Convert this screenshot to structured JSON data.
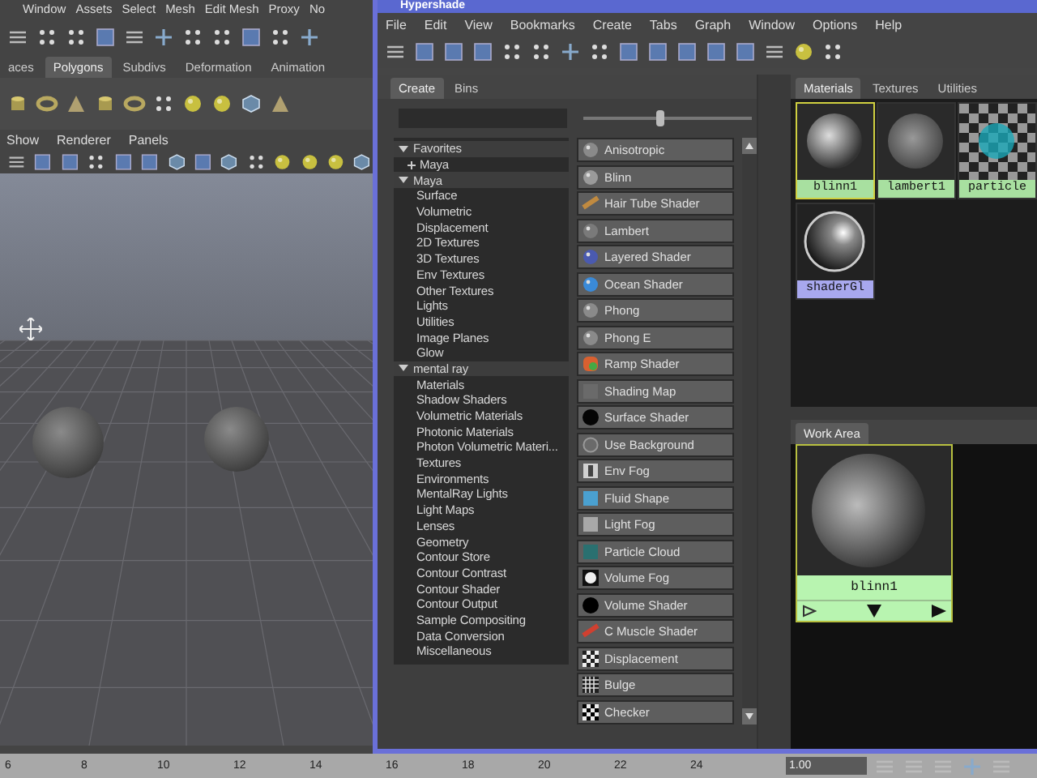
{
  "maya": {
    "menu": [
      "Window",
      "Assets",
      "Select",
      "Mesh",
      "Edit Mesh",
      "Proxy",
      "No"
    ],
    "shelf_tabs": [
      {
        "label": "aces",
        "selected": false
      },
      {
        "label": "Polygons",
        "selected": true
      },
      {
        "label": "Subdivs",
        "selected": false
      },
      {
        "label": "Deformation",
        "selected": false
      },
      {
        "label": "Animation",
        "selected": false
      }
    ],
    "panel_menu": [
      "Show",
      "Renderer",
      "Panels"
    ]
  },
  "hypershade": {
    "title": "Hypershade",
    "menu": [
      "File",
      "Edit",
      "View",
      "Bookmarks",
      "Create",
      "Tabs",
      "Graph",
      "Window",
      "Options",
      "Help"
    ],
    "create_tabs": [
      {
        "label": "Create",
        "selected": true
      },
      {
        "label": "Bins",
        "selected": false
      }
    ],
    "swatch_size": {
      "level": 0.45
    },
    "tree": [
      {
        "label": "Favorites",
        "expanded": true,
        "children": [
          {
            "label": "Maya",
            "expanded": false
          }
        ]
      },
      {
        "label": "Maya",
        "expanded": true,
        "children": [
          {
            "label": "Surface"
          },
          {
            "label": "Volumetric"
          },
          {
            "label": "Displacement"
          },
          {
            "label": "2D Textures"
          },
          {
            "label": "3D Textures"
          },
          {
            "label": "Env Textures"
          },
          {
            "label": "Other Textures"
          },
          {
            "label": "Lights"
          },
          {
            "label": "Utilities"
          },
          {
            "label": "Image Planes"
          },
          {
            "label": "Glow"
          }
        ]
      },
      {
        "label": "mental ray",
        "expanded": true,
        "children": [
          {
            "label": "Materials"
          },
          {
            "label": "Shadow Shaders"
          },
          {
            "label": "Volumetric Materials"
          },
          {
            "label": "Photonic Materials"
          },
          {
            "label": "Photon Volumetric Materi..."
          },
          {
            "label": "Textures"
          },
          {
            "label": "Environments"
          },
          {
            "label": "MentalRay Lights"
          },
          {
            "label": "Light Maps"
          },
          {
            "label": "Lenses"
          },
          {
            "label": "Geometry"
          },
          {
            "label": "Contour Store"
          },
          {
            "label": "Contour Contrast"
          },
          {
            "label": "Contour Shader"
          },
          {
            "label": "Contour Output"
          },
          {
            "label": "Sample Compositing"
          },
          {
            "label": "Data Conversion"
          },
          {
            "label": "Miscellaneous"
          }
        ]
      }
    ],
    "shaders": [
      {
        "label": "Anisotropic",
        "kind": "sphere",
        "color": "#8a8a8a"
      },
      {
        "label": "Blinn",
        "kind": "sphere",
        "color": "#9a9a9a"
      },
      {
        "label": "Hair Tube Shader",
        "kind": "stroke",
        "color": "#c08a40"
      },
      {
        "label": "Lambert",
        "kind": "sphere",
        "color": "#7a7a7a"
      },
      {
        "label": "Layered Shader",
        "kind": "sphere",
        "color": "#4a5ab0"
      },
      {
        "label": "Ocean Shader",
        "kind": "sphere",
        "color": "#3a8ad8"
      },
      {
        "label": "Phong",
        "kind": "sphere",
        "color": "#8a8a8a"
      },
      {
        "label": "Phong E",
        "kind": "sphere",
        "color": "#8a8a8a"
      },
      {
        "label": "Ramp Shader",
        "kind": "ramp",
        "color": "#d86030"
      },
      {
        "label": "Shading Map",
        "kind": "square",
        "color": "#6a6a6a"
      },
      {
        "label": "Surface Shader",
        "kind": "disc",
        "color": "#050505"
      },
      {
        "label": "Use Background",
        "kind": "ring",
        "color": "#6a6a6a"
      },
      {
        "label": "Env Fog",
        "kind": "fog",
        "color": "#d0d0d0"
      },
      {
        "label": "Fluid Shape",
        "kind": "square",
        "color": "#4aa0d0"
      },
      {
        "label": "Light Fog",
        "kind": "square",
        "color": "#a8a8a8"
      },
      {
        "label": "Particle Cloud",
        "kind": "square",
        "color": "#2a7070"
      },
      {
        "label": "Volume Fog",
        "kind": "glow",
        "color": "#f0f0f0"
      },
      {
        "label": "Volume Shader",
        "kind": "disc",
        "color": "#000000"
      },
      {
        "label": "C Muscle Shader",
        "kind": "stroke",
        "color": "#d04030"
      },
      {
        "label": "Displacement",
        "kind": "checker",
        "color": "#202020"
      },
      {
        "label": "Bulge",
        "kind": "grid",
        "color": "#202020"
      },
      {
        "label": "Checker",
        "kind": "checker",
        "color": "#000000"
      }
    ],
    "bin_tabs": [
      {
        "label": "Materials",
        "selected": true
      },
      {
        "label": "Textures",
        "selected": false
      },
      {
        "label": "Utilities",
        "selected": false
      }
    ],
    "materials": [
      {
        "name": "blinn1",
        "selected": true,
        "kind": "shiny",
        "color": "#a8e0a0"
      },
      {
        "name": "lambert1",
        "selected": false,
        "kind": "matte",
        "color": "#a8e0a0"
      },
      {
        "name": "particle",
        "selected": false,
        "kind": "checker",
        "color": "#a8e0a0"
      },
      {
        "name": "shaderGl",
        "selected": false,
        "kind": "glow",
        "color": "#a8a8ee"
      }
    ],
    "work_area": {
      "tab": "Work Area",
      "node": {
        "name": "blinn1"
      }
    }
  },
  "timeline": {
    "ticks": [
      "6",
      "8",
      "10",
      "12",
      "14",
      "16",
      "18",
      "20",
      "22",
      "24"
    ],
    "current_time": "1.00"
  }
}
